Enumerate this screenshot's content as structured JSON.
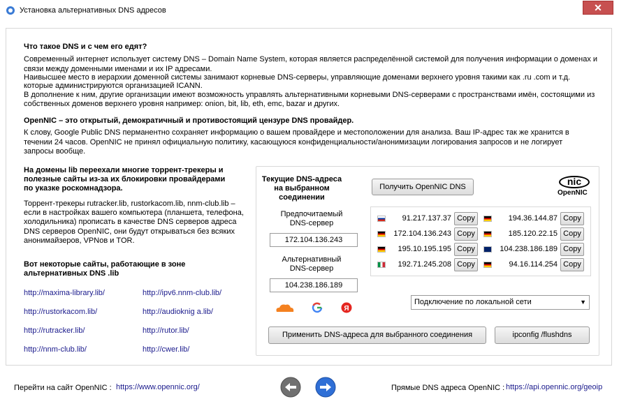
{
  "window": {
    "title": "Установка альтернативных DNS адресов",
    "close_label": "✕"
  },
  "intro": {
    "heading1": "Что такое DNS и с чем его едят?",
    "para1_line1": "Современный интернет использует систему DNS – Domain Name System, которая является распределённой системой для получения информации о доменах и",
    "para1_line2": "связи между доменными именами и их IP адресами.",
    "para1_line3": "Наивысшее место в иерархии доменной системы занимают корневые DNS-серверы, управляющие доменами верхнего уровня такими как .ru .com и т.д.",
    "para1_line4": "которые администрируются организацией ICANN.",
    "para1_line5": "В дополнение к ним, другие организации имеют возможность управлять альтернативными корневыми DNS-серверами с пространствами имён, состоящими из",
    "para1_line6": "собственных доменов верхнего уровня например: onion, bit, lib, eth, emc, bazar и других.",
    "heading2": "OpenNIC – это открытый, демократичный и противостоящий цензуре DNS провайдер.",
    "para2_line1": "К слову, Google Public DNS перманентно сохраняет информацию о вашем провайдере и местоположении для анализа. Ваш IP-адрес так же хранится в",
    "para2_line2": "течении 24 часов. OpenNIC не принял официальную политику, касающуюся конфиденциальности/анонимизации логирования запросов и не логирует",
    "para2_line3": "запросы вообще."
  },
  "left": {
    "heading_line1": "На домены  lib переехали многие торрент-трекеры и",
    "heading_line2": "полезные сайты из-за их блокировки провайдерами",
    "heading_line3": "по указке роскомнадзора.",
    "para_line1": "Торрент-трекеры rutracker.lib, rustorkacom.lib, nnm-club.lib –",
    "para_line2": "если в настройках вашего компьютера (планшета, телефона,",
    "para_line3": "холодильника) прописать в качестве DNS серверов адреса",
    "para_line4": "DNS серверов OpenNIC, они будут открываться без всяких",
    "para_line5": "анонимайзеров, VPNов и TOR.",
    "sites_heading_line1": "Вот некоторые сайты, работающие в зоне",
    "sites_heading_line2": "альтернативных DNS .lib",
    "links_col1": [
      "http://maxima-library.lib/",
      "http://rustorkacom.lib/",
      "http://rutracker.lib/",
      "http://nnm-club.lib/"
    ],
    "links_col2": [
      "http://ipv6.nnm-club.lib/",
      "http://audioknig a.lib/",
      "http://rutor.lib/",
      "http://cwer.lib/"
    ]
  },
  "dns": {
    "current_line1": "Текущие DNS-адреса",
    "current_line2": "на выбранном",
    "current_line3": "соединении",
    "preferred_line1": "Предпочитаемый",
    "preferred_line2": "DNS-сервер",
    "preferred_value": "172.104.136.243",
    "alternate_line1": "Альтернативный",
    "alternate_line2": "DNS-сервер",
    "alternate_value": "104.238.186.189",
    "get_button": "Получить OpenNIC DNS",
    "logo_nic": "nic",
    "logo_opennic": "OpenNIC",
    "copy_label": "Copy",
    "servers": [
      {
        "flag": "ru",
        "ip": "91.217.137.37"
      },
      {
        "flag": "de",
        "ip": "194.36.144.87"
      },
      {
        "flag": "de",
        "ip": "172.104.136.243"
      },
      {
        "flag": "de",
        "ip": "185.120.22.15"
      },
      {
        "flag": "de",
        "ip": "195.10.195.195"
      },
      {
        "flag": "gb",
        "ip": "104.238.186.189"
      },
      {
        "flag": "it",
        "ip": "192.71.245.208"
      },
      {
        "flag": "de",
        "ip": "94.16.114.254"
      }
    ],
    "connection_selected": "Подключение по локальной сети",
    "apply_button": "Применить DNS-адреса для выбранного соединения",
    "flush_button": "ipconfig /flushdns"
  },
  "footer": {
    "goto_label": "Перейти на сайт OpenNIC :",
    "goto_link": "https://www.opennic.org/",
    "direct_label": "Прямые DNS адреса OpenNIC :",
    "direct_link": "https://api.opennic.org/geoip"
  },
  "colors": {
    "link": "#1a1a8c",
    "nav_blue": "#2f6fd6",
    "nav_gray": "#707070"
  }
}
